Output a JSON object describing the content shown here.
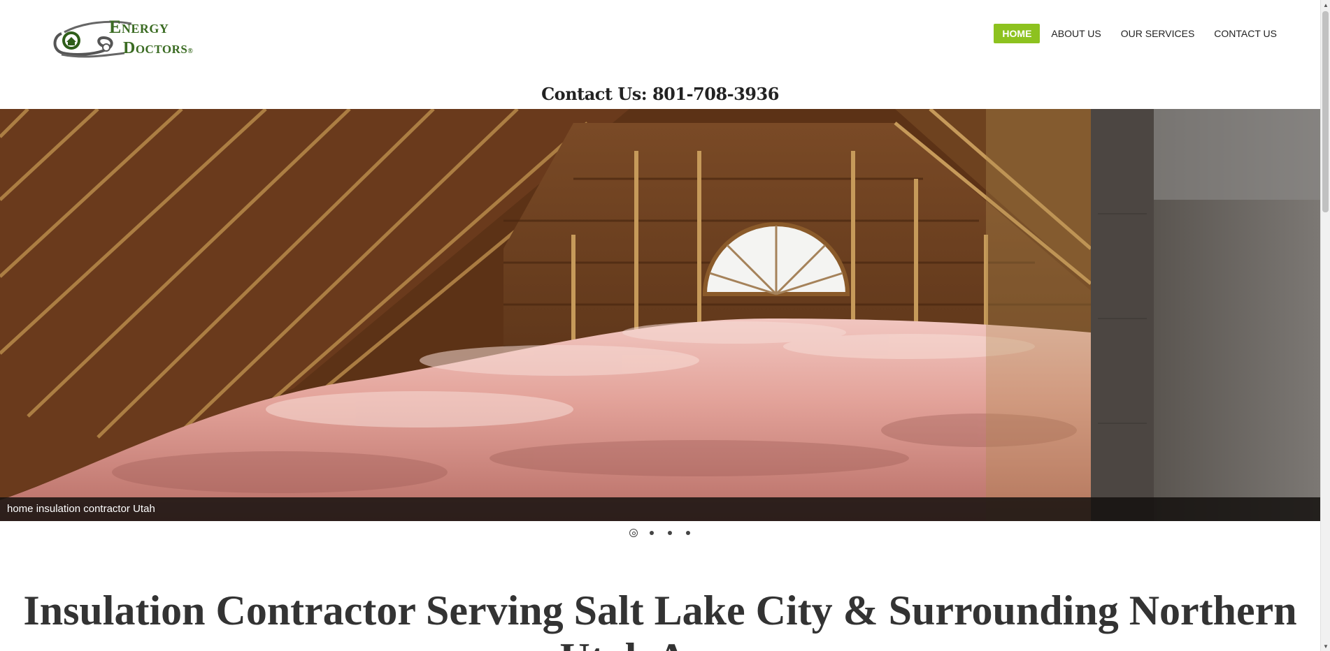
{
  "brand": {
    "logo_line1": "Energy",
    "logo_line2": "Doctors",
    "logo_mark": "®",
    "brand_color": "#3a6b22"
  },
  "nav": {
    "items": [
      {
        "label": "HOME",
        "active": true
      },
      {
        "label": "ABOUT US",
        "active": false
      },
      {
        "label": "OUR SERVICES",
        "active": false
      },
      {
        "label": "CONTACT US",
        "active": false
      }
    ],
    "active_color": "#8dc21f"
  },
  "contact_line": "Contact Us: 801-708-3936",
  "slider": {
    "caption": "home insulation contractor Utah",
    "slide_count": 4,
    "active_slide": 1
  },
  "main_heading": "Insulation Contractor Serving Salt Lake City & Surrounding Northern Utah Areas"
}
